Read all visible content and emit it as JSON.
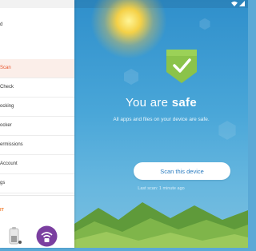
{
  "drawer": {
    "title": "d",
    "items": [
      {
        "label": "Scan",
        "active": true
      },
      {
        "label": "Check",
        "active": false
      },
      {
        "label": "ocking",
        "active": false
      },
      {
        "label": "ocker",
        "active": false
      },
      {
        "label": "ermissions",
        "active": false
      },
      {
        "label": "Account",
        "active": false
      },
      {
        "label": "gs",
        "active": false
      }
    ],
    "promo": "IT",
    "bottom_apps": [
      {
        "icon": "battery-saver-icon"
      },
      {
        "icon": "wifi-lock-icon"
      }
    ]
  },
  "status": {
    "icons": [
      "wifi-icon",
      "signal-icon"
    ]
  },
  "hero": {
    "title_prefix": "You are ",
    "title_emphasis": "safe",
    "subtitle": "All apps and files on your device are safe.",
    "scan_button": "Scan this device",
    "last_scan": "Last scan: 1 minute ago"
  },
  "colors": {
    "accent": "#e8552e",
    "shield_green": "#8bc34a",
    "sky": "#49a6d8",
    "button_text": "#2b7cc0",
    "wifi_app_bg": "#7b3fa0"
  }
}
